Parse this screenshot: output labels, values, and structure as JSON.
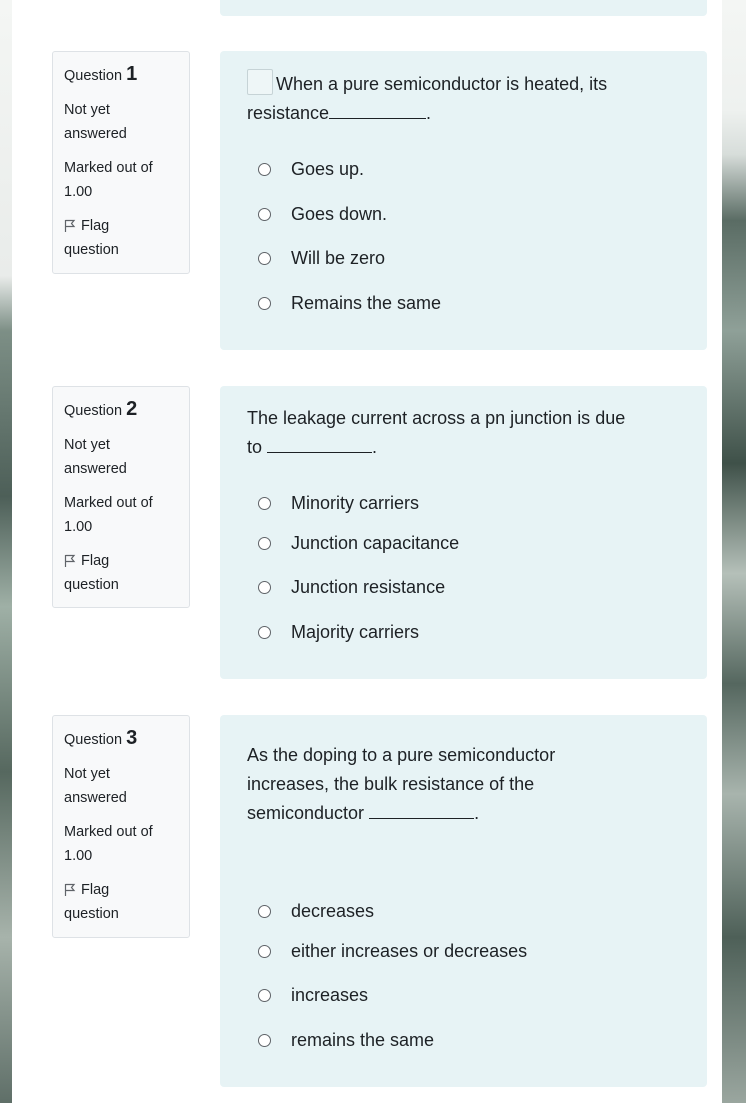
{
  "questions": [
    {
      "label": "Question",
      "number": "1",
      "state": "Not yet answered",
      "state_l1": "Not yet",
      "state_l2": "answered",
      "marked_l1": "Marked out of",
      "marked_l2": "1.00",
      "flag_l1": "Flag",
      "flag_l2": "question",
      "text_l1": "When a pure semiconductor is heated, its",
      "text_l2": "resistance",
      "text_end": ".",
      "answers": [
        "Goes up.",
        "Goes down.",
        "Will be zero",
        "Remains the same"
      ]
    },
    {
      "label": "Question",
      "number": "2",
      "state_l1": "Not yet",
      "state_l2": "answered",
      "marked_l1": "Marked out of",
      "marked_l2": "1.00",
      "flag_l1": "Flag",
      "flag_l2": "question",
      "text_l1": "The leakage current across a pn junction is due",
      "text_l2": "to",
      "text_end": ".",
      "answers": [
        "Minority carriers",
        "Junction capacitance",
        "Junction resistance",
        "Majority carriers"
      ]
    },
    {
      "label": "Question",
      "number": "3",
      "state_l1": "Not yet",
      "state_l2": "answered",
      "marked_l1": "Marked out of",
      "marked_l2": "1.00",
      "flag_l1": "Flag",
      "flag_l2": "question",
      "text_l1": "As the doping to a pure semiconductor",
      "text_l2": "increases, the bulk resistance of the",
      "text_l3": "semiconductor",
      "text_end": ".",
      "answers": [
        "decreases",
        "either increases or decreases",
        "increases",
        "remains the same"
      ]
    }
  ],
  "colors": {
    "content_bg": "#e7f3f5",
    "info_bg": "#f8f9fa",
    "text": "#1d2125"
  }
}
